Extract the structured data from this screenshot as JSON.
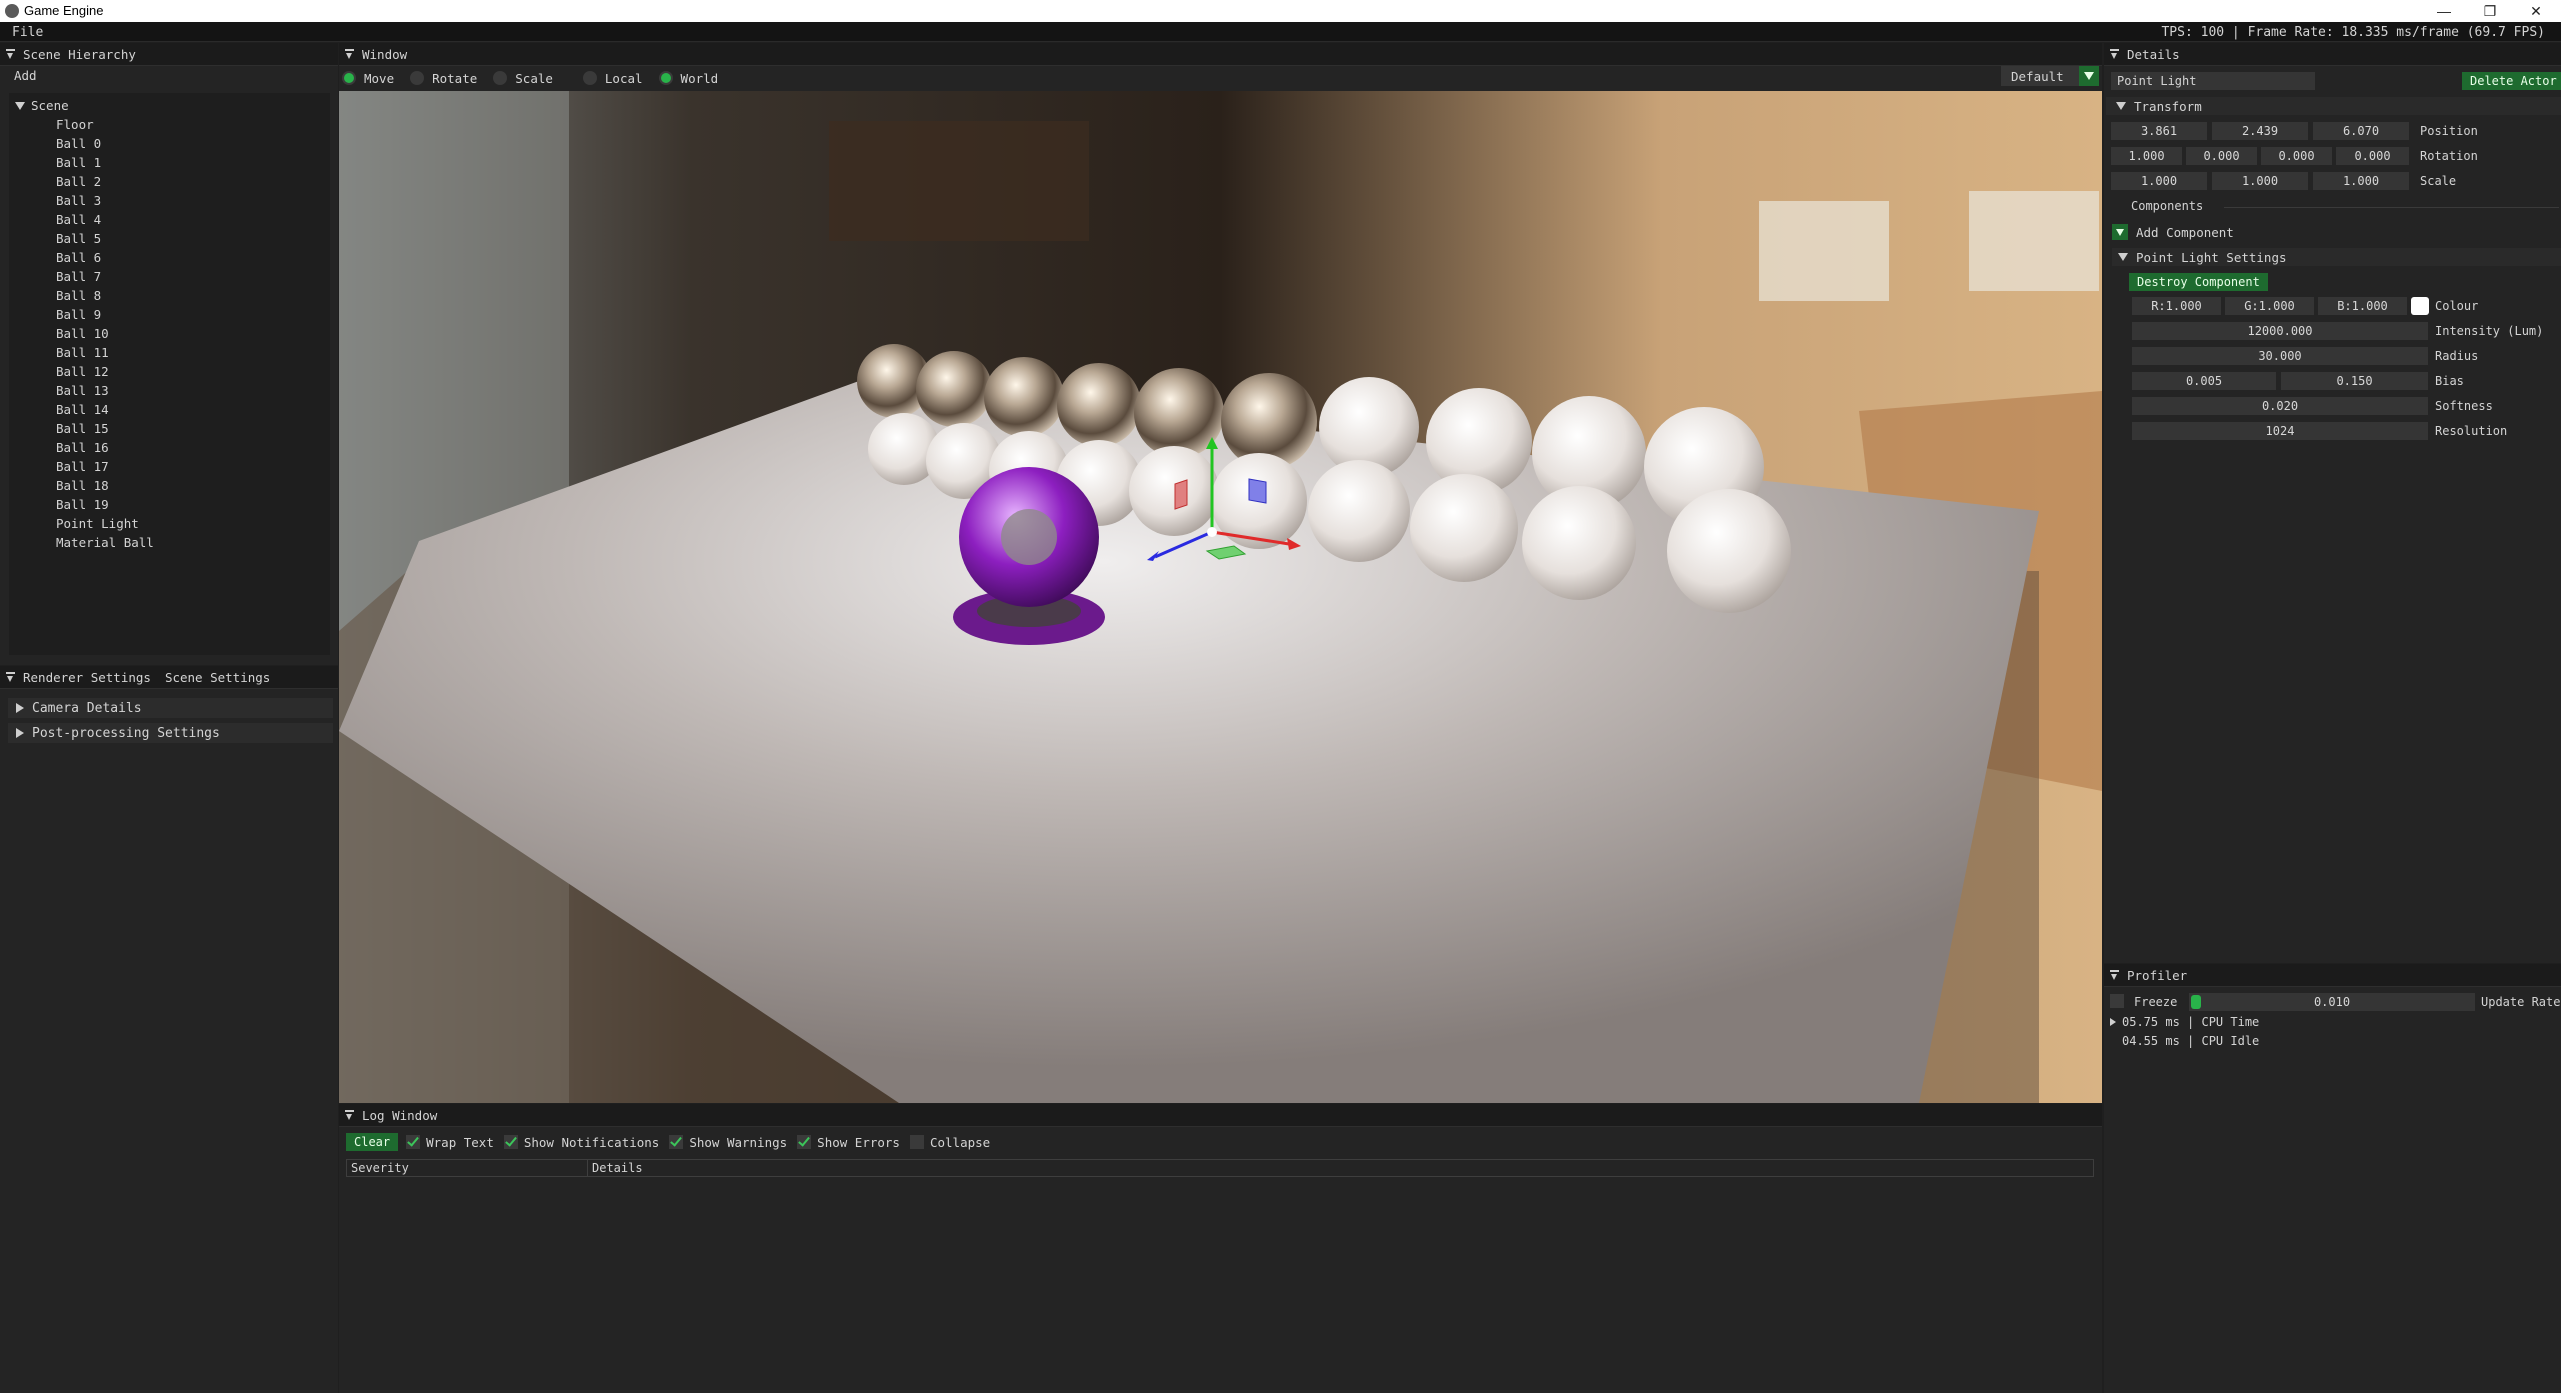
{
  "window": {
    "title": "Game Engine",
    "minimize": "—",
    "restore": "❐",
    "close": "✕"
  },
  "menubar": {
    "file": "File",
    "stats": "TPS: 100 | Frame Rate: 18.335 ms/frame (69.7 FPS)"
  },
  "hierarchy": {
    "title": "Scene Hierarchy",
    "add": "Add",
    "root": "Scene",
    "items": [
      "Floor",
      "Ball 0",
      "Ball 1",
      "Ball 2",
      "Ball 3",
      "Ball 4",
      "Ball 5",
      "Ball 6",
      "Ball 7",
      "Ball 8",
      "Ball 9",
      "Ball 10",
      "Ball 11",
      "Ball 12",
      "Ball 13",
      "Ball 14",
      "Ball 15",
      "Ball 16",
      "Ball 17",
      "Ball 18",
      "Ball 19",
      "Point Light",
      "Material Ball"
    ]
  },
  "settings": {
    "tab_renderer": "Renderer Settings",
    "tab_scene": "Scene Settings",
    "camera": "Camera Details",
    "postfx": "Post-processing Settings"
  },
  "viewport": {
    "title": "Window",
    "move": "Move",
    "rotate": "Rotate",
    "scale": "Scale",
    "local": "Local",
    "world": "World",
    "camera_select": "Default",
    "selected_tool": "move",
    "selected_space": "world"
  },
  "details": {
    "title": "Details",
    "actor_name": "Point Light",
    "delete_actor": "Delete Actor",
    "transform": "Transform",
    "position": {
      "label": "Position",
      "x": "3.861",
      "y": "2.439",
      "z": "6.070"
    },
    "rotation": {
      "label": "Rotation",
      "x": "1.000",
      "y": "0.000",
      "z": "0.000",
      "w": "0.000"
    },
    "scale": {
      "label": "Scale",
      "x": "1.000",
      "y": "1.000",
      "z": "1.000"
    },
    "components": "Components",
    "add_component": "Add Component",
    "point_light_settings": "Point Light Settings",
    "destroy_component": "Destroy Component",
    "colour": {
      "label": "Colour",
      "r": "R:1.000",
      "g": "G:1.000",
      "b": "B:1.000",
      "swatch": "#ffffff"
    },
    "intensity": {
      "label": "Intensity (Lum)",
      "value": "12000.000"
    },
    "radius": {
      "label": "Radius",
      "value": "30.000"
    },
    "bias": {
      "label": "Bias",
      "a": "0.005",
      "b": "0.150"
    },
    "softness": {
      "label": "Softness",
      "value": "0.020"
    },
    "resolution": {
      "label": "Resolution",
      "value": "1024"
    }
  },
  "profiler": {
    "title": "Profiler",
    "freeze": "Freeze",
    "update_rate_value": "0.010",
    "update_rate_label": "Update Rate",
    "cpu_time": "05.75 ms | CPU Time",
    "cpu_idle": "04.55 ms | CPU Idle"
  },
  "log": {
    "title": "Log Window",
    "clear": "Clear",
    "wrap_text": "Wrap Text",
    "show_notifications": "Show Notifications",
    "show_warnings": "Show Warnings",
    "show_errors": "Show Errors",
    "collapse": "Collapse",
    "col_severity": "Severity",
    "col_details": "Details"
  },
  "colors": {
    "accent_green": "#1e6b2f",
    "radio_green": "#29b34a",
    "panel": "#242424",
    "header": "#1b1b1b"
  }
}
